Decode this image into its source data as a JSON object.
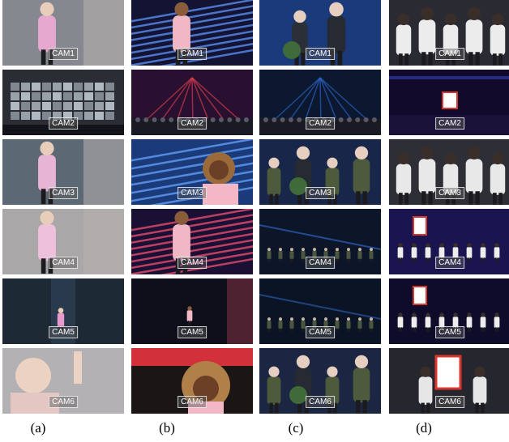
{
  "columns": [
    {
      "caption": "(a)",
      "scene": "solo dancer in pink traditional dress",
      "frames": [
        {
          "camera": "CAM1",
          "bg": "#85898f",
          "accent": "#e7a8cf",
          "subject": "dancer-pink"
        },
        {
          "camera": "CAM2",
          "bg": "#2a2d33",
          "accent": "#c8d2dc",
          "subject": "screen-wall"
        },
        {
          "camera": "CAM3",
          "bg": "#5c6874",
          "accent": "#e7b4d6",
          "subject": "dancer-pink"
        },
        {
          "camera": "CAM4",
          "bg": "#a9a7a8",
          "accent": "#eec0dc",
          "subject": "dancer-pink"
        },
        {
          "camera": "CAM5",
          "bg": "#1d2a36",
          "accent": "#e79acb",
          "subject": "dancer-small"
        },
        {
          "camera": "CAM6",
          "bg": "#b4b1b4",
          "accent": "#e4c6c2",
          "subject": "dancer-closeup"
        }
      ]
    },
    {
      "caption": "(b)",
      "scene": "singer with laser stripe backdrop",
      "frames": [
        {
          "camera": "CAM1",
          "bg": "#131433",
          "accent": "#5a8cf0",
          "subject": "singer-pink"
        },
        {
          "camera": "CAM2",
          "bg": "#2a1030",
          "accent": "#e8404f",
          "subject": "stage-wide"
        },
        {
          "camera": "CAM3",
          "bg": "#1a3a7a",
          "accent": "#5f97ee",
          "subject": "singer-curly"
        },
        {
          "camera": "CAM4",
          "bg": "#1a1034",
          "accent": "#e44d6e",
          "subject": "singer-pink"
        },
        {
          "camera": "CAM5",
          "bg": "#0e0f1a",
          "accent": "#c9475e",
          "subject": "singer-small"
        },
        {
          "camera": "CAM6",
          "bg": "#1b1516",
          "accent": "#d3313a",
          "subject": "singer-closeup"
        }
      ]
    },
    {
      "caption": "(c)",
      "scene": "duo on blue-lit stage with chorus",
      "frames": [
        {
          "camera": "CAM1",
          "bg": "#1a3a7a",
          "accent": "#2f5fb8",
          "subject": "duo"
        },
        {
          "camera": "CAM2",
          "bg": "#0c1830",
          "accent": "#2c6ad1",
          "subject": "stage-wide"
        },
        {
          "camera": "CAM3",
          "bg": "#18264a",
          "accent": "#3a5a8c",
          "subject": "duo-group"
        },
        {
          "camera": "CAM4",
          "bg": "#0c1628",
          "accent": "#2d61c0",
          "subject": "chorus"
        },
        {
          "camera": "CAM5",
          "bg": "#0a1424",
          "accent": "#2a58a8",
          "subject": "chorus"
        },
        {
          "camera": "CAM6",
          "bg": "#1a2642",
          "accent": "#3a62aa",
          "subject": "duo-group"
        }
      ]
    },
    {
      "caption": "(d)",
      "scene": "dance crew in white shirts with logo",
      "frames": [
        {
          "camera": "CAM1",
          "bg": "#2a2a33",
          "accent": "#ececec",
          "subject": "crew"
        },
        {
          "camera": "CAM2",
          "bg": "#120a2a",
          "accent": "#3a49d8",
          "subject": "logo-wide"
        },
        {
          "camera": "CAM3",
          "bg": "#2e2e36",
          "accent": "#e8e8e8",
          "subject": "crew"
        },
        {
          "camera": "CAM4",
          "bg": "#1a1550",
          "accent": "#5a55e0",
          "subject": "crew-logo"
        },
        {
          "camera": "CAM5",
          "bg": "#0f0b2a",
          "accent": "#4a4ad0",
          "subject": "crew-logo"
        },
        {
          "camera": "CAM6",
          "bg": "#26262e",
          "accent": "#e6e6e6",
          "subject": "crew-logo-close"
        }
      ]
    }
  ]
}
